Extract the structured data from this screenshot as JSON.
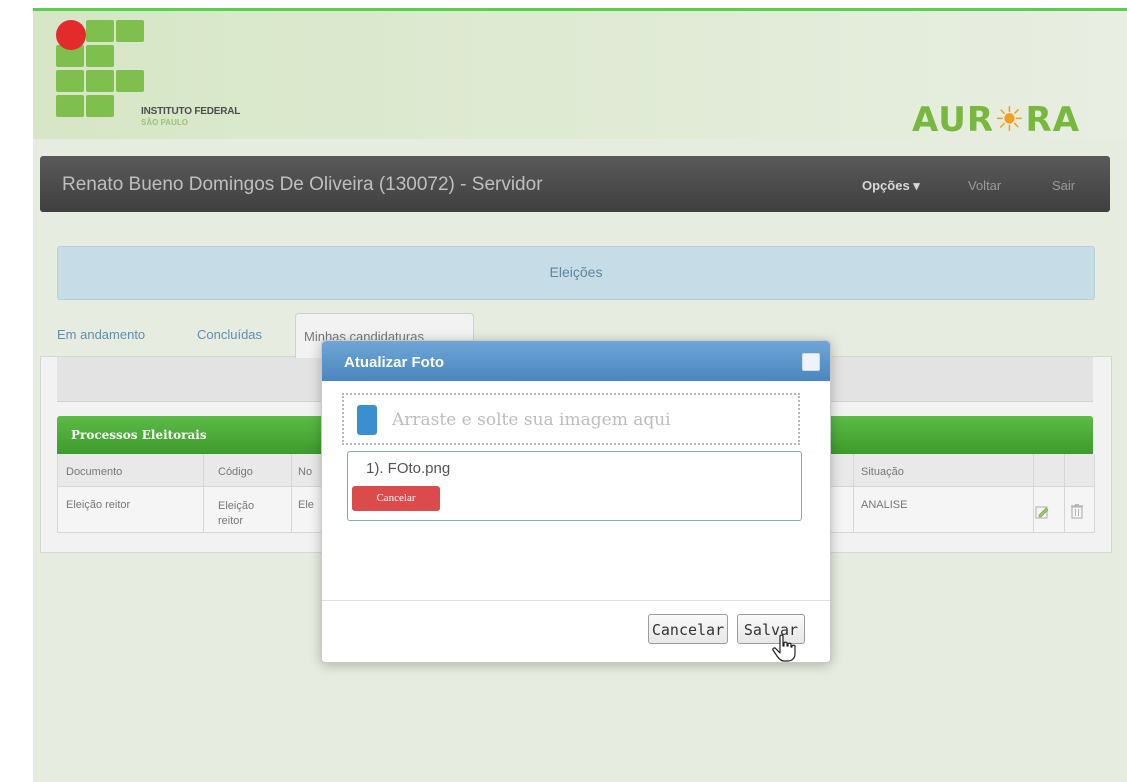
{
  "header": {
    "institution_line1": "INSTITUTO FEDERAL",
    "institution_line2": "SÃO PAULO",
    "brand_left": "AUR",
    "brand_right": "RA"
  },
  "navbar": {
    "user_title": "Renato Bueno Domingos De Oliveira (130072) - Servidor",
    "options_label": "Opções ▾",
    "back_label": "Voltar",
    "exit_label": "Sair"
  },
  "banner": {
    "title": "Eleições"
  },
  "tabs": [
    {
      "label": "Em andamento"
    },
    {
      "label": "Concluídas"
    },
    {
      "label": "Minhas candidaturas"
    }
  ],
  "table": {
    "title": "Processos Eleitorais",
    "columns": [
      "Documento",
      "Código",
      "No",
      "Situação"
    ],
    "rows": [
      {
        "documento": "Eleição reitor",
        "codigo": "Eleição reitor",
        "nome": "Ele",
        "situacao": "ANALISE"
      }
    ]
  },
  "modal": {
    "title": "Atualizar Foto",
    "dropzone_text": "Arraste e solte sua imagem aqui",
    "file_name": "1). FOto.png",
    "file_cancel_label": "Cancelar",
    "cancel_label": "Cancelar",
    "save_label": "Salvar"
  },
  "colors": {
    "top_accent": "#55d24a",
    "navbar": "#4a4a4a",
    "table_header": "#4aa935",
    "modal_title": "#5a94c9",
    "danger": "#dc4b4b"
  }
}
